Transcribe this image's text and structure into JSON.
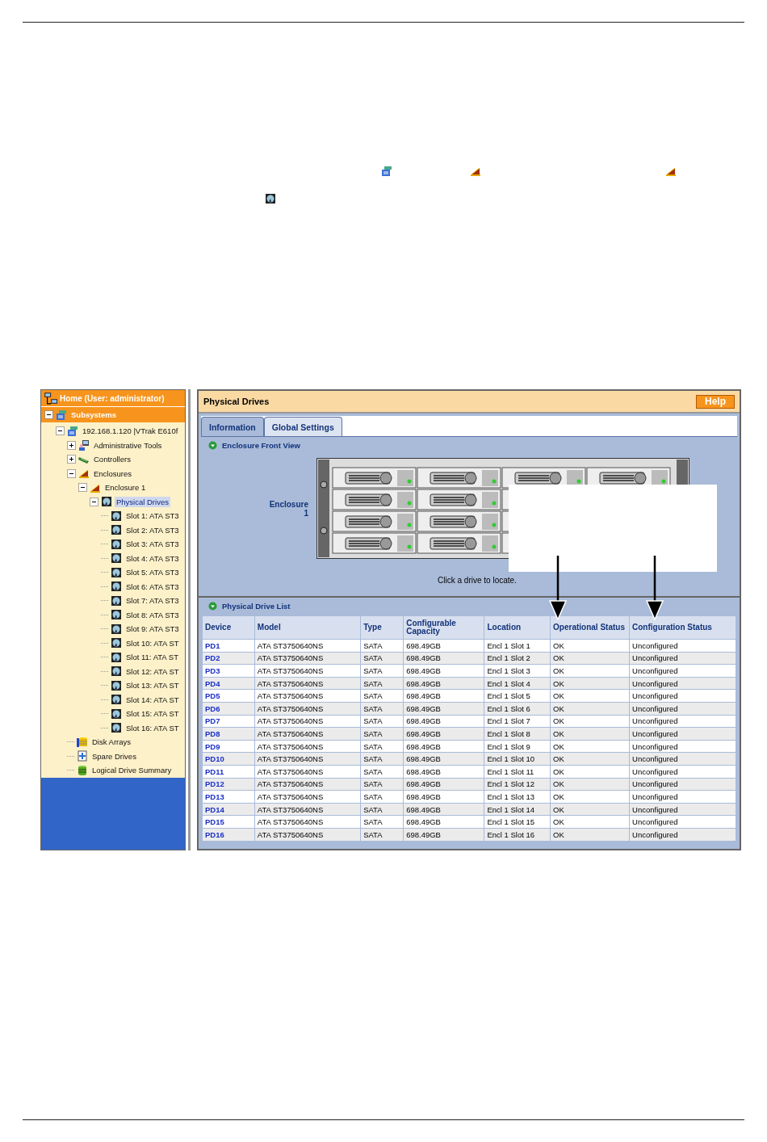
{
  "tree": {
    "home": "Home (User: administrator)",
    "items": [
      {
        "label": "Subsystems",
        "kind": "subsystems",
        "expanded": true,
        "selected": false,
        "children": [
          {
            "label": "192.168.1.120 |VTrak E610f",
            "kind": "subsystem",
            "expanded": true,
            "selected": false,
            "children": [
              {
                "label": "Administrative Tools",
                "kind": "tools",
                "expanded": false,
                "selected": false
              },
              {
                "label": "Controllers",
                "kind": "controllers",
                "expanded": false,
                "selected": false
              },
              {
                "label": "Enclosures",
                "kind": "enclosure",
                "expanded": true,
                "selected": false,
                "children": [
                  {
                    "label": "Enclosure 1",
                    "kind": "enclosure",
                    "expanded": true,
                    "selected": false,
                    "children": [
                      {
                        "label": "Physical Drives",
                        "kind": "drive",
                        "expanded": true,
                        "selected": true,
                        "children": [
                          {
                            "label": "Slot 1: ATA ST3",
                            "kind": "drive",
                            "selected": false
                          },
                          {
                            "label": "Slot 2: ATA ST3",
                            "kind": "drive",
                            "selected": false
                          },
                          {
                            "label": "Slot 3: ATA ST3",
                            "kind": "drive",
                            "selected": false
                          },
                          {
                            "label": "Slot 4: ATA ST3",
                            "kind": "drive",
                            "selected": false
                          },
                          {
                            "label": "Slot 5: ATA ST3",
                            "kind": "drive",
                            "selected": false
                          },
                          {
                            "label": "Slot 6: ATA ST3",
                            "kind": "drive",
                            "selected": false
                          },
                          {
                            "label": "Slot 7: ATA ST3",
                            "kind": "drive",
                            "selected": false
                          },
                          {
                            "label": "Slot 8: ATA ST3",
                            "kind": "drive",
                            "selected": false
                          },
                          {
                            "label": "Slot 9: ATA ST3",
                            "kind": "drive",
                            "selected": false
                          },
                          {
                            "label": "Slot 10: ATA ST",
                            "kind": "drive",
                            "selected": false
                          },
                          {
                            "label": "Slot 11: ATA ST",
                            "kind": "drive",
                            "selected": false
                          },
                          {
                            "label": "Slot 12: ATA ST",
                            "kind": "drive",
                            "selected": false
                          },
                          {
                            "label": "Slot 13: ATA ST",
                            "kind": "drive",
                            "selected": false
                          },
                          {
                            "label": "Slot 14: ATA ST",
                            "kind": "drive",
                            "selected": false
                          },
                          {
                            "label": "Slot 15: ATA ST",
                            "kind": "drive",
                            "selected": false
                          },
                          {
                            "label": "Slot 16: ATA ST",
                            "kind": "drive",
                            "selected": false
                          }
                        ]
                      }
                    ]
                  }
                ]
              },
              {
                "label": "Disk Arrays",
                "kind": "arrays",
                "selected": false
              },
              {
                "label": "Spare Drives",
                "kind": "spare",
                "selected": false
              },
              {
                "label": "Logical Drive Summary",
                "kind": "logical",
                "selected": false
              }
            ]
          }
        ]
      }
    ]
  },
  "panel": {
    "title": "Physical Drives",
    "help": "Help",
    "tabs": [
      {
        "label": "Information",
        "selected": true
      },
      {
        "label": "Global Settings",
        "selected": false
      }
    ],
    "front_view": {
      "heading": "Enclosure Front View",
      "enclosure_label": "Enclosure 1",
      "hint": "Click a drive to locate."
    },
    "drive_list": {
      "heading": "Physical Drive List",
      "columns": [
        "Device",
        "Model",
        "Type",
        "Configurable Capacity",
        "Location",
        "Operational Status",
        "Configuration Status"
      ],
      "rows": [
        [
          "PD1",
          "ATA ST3750640NS",
          "SATA",
          "698.49GB",
          "Encl 1 Slot 1",
          "OK",
          "Unconfigured"
        ],
        [
          "PD2",
          "ATA ST3750640NS",
          "SATA",
          "698.49GB",
          "Encl 1 Slot 2",
          "OK",
          "Unconfigured"
        ],
        [
          "PD3",
          "ATA ST3750640NS",
          "SATA",
          "698.49GB",
          "Encl 1 Slot 3",
          "OK",
          "Unconfigured"
        ],
        [
          "PD4",
          "ATA ST3750640NS",
          "SATA",
          "698.49GB",
          "Encl 1 Slot 4",
          "OK",
          "Unconfigured"
        ],
        [
          "PD5",
          "ATA ST3750640NS",
          "SATA",
          "698.49GB",
          "Encl 1 Slot 5",
          "OK",
          "Unconfigured"
        ],
        [
          "PD6",
          "ATA ST3750640NS",
          "SATA",
          "698.49GB",
          "Encl 1 Slot 6",
          "OK",
          "Unconfigured"
        ],
        [
          "PD7",
          "ATA ST3750640NS",
          "SATA",
          "698.49GB",
          "Encl 1 Slot 7",
          "OK",
          "Unconfigured"
        ],
        [
          "PD8",
          "ATA ST3750640NS",
          "SATA",
          "698.49GB",
          "Encl 1 Slot 8",
          "OK",
          "Unconfigured"
        ],
        [
          "PD9",
          "ATA ST3750640NS",
          "SATA",
          "698.49GB",
          "Encl 1 Slot 9",
          "OK",
          "Unconfigured"
        ],
        [
          "PD10",
          "ATA ST3750640NS",
          "SATA",
          "698.49GB",
          "Encl 1 Slot 10",
          "OK",
          "Unconfigured"
        ],
        [
          "PD11",
          "ATA ST3750640NS",
          "SATA",
          "698.49GB",
          "Encl 1 Slot 11",
          "OK",
          "Unconfigured"
        ],
        [
          "PD12",
          "ATA ST3750640NS",
          "SATA",
          "698.49GB",
          "Encl 1 Slot 12",
          "OK",
          "Unconfigured"
        ],
        [
          "PD13",
          "ATA ST3750640NS",
          "SATA",
          "698.49GB",
          "Encl 1 Slot 13",
          "OK",
          "Unconfigured"
        ],
        [
          "PD14",
          "ATA ST3750640NS",
          "SATA",
          "698.49GB",
          "Encl 1 Slot 14",
          "OK",
          "Unconfigured"
        ],
        [
          "PD15",
          "ATA ST3750640NS",
          "SATA",
          "698.49GB",
          "Encl 1 Slot 15",
          "OK",
          "Unconfigured"
        ],
        [
          "PD16",
          "ATA ST3750640NS",
          "SATA",
          "698.49GB",
          "Encl 1 Slot 16",
          "OK",
          "Unconfigured"
        ]
      ]
    }
  }
}
